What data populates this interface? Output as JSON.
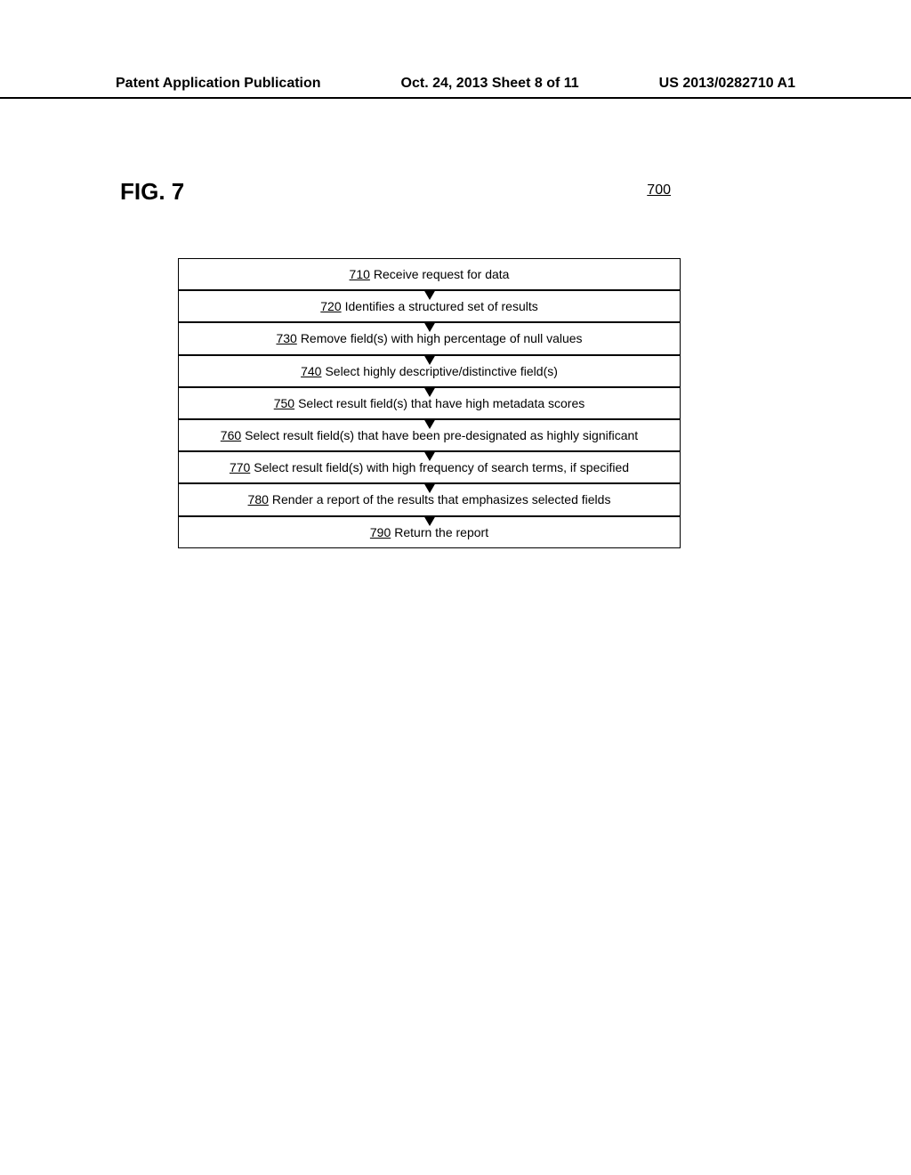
{
  "header": {
    "left": "Patent Application Publication",
    "center": "Oct. 24, 2013  Sheet 8 of 11",
    "right": "US 2013/0282710 A1"
  },
  "figure": {
    "label": "FIG. 7",
    "number": "700"
  },
  "steps": [
    {
      "num": "710",
      "text": "Receive request for data"
    },
    {
      "num": "720",
      "text": "Identifies a structured set of results"
    },
    {
      "num": "730",
      "text": "Remove field(s) with high percentage of null values"
    },
    {
      "num": "740",
      "text": "Select highly descriptive/distinctive field(s)"
    },
    {
      "num": "750",
      "text": "Select result field(s) that have high metadata scores"
    },
    {
      "num": "760",
      "text": "Select result field(s) that have been pre-designated as highly significant"
    },
    {
      "num": "770",
      "text": "Select result field(s) with high frequency of search terms, if specified"
    },
    {
      "num": "780",
      "text": "Render a report of the results that emphasizes selected fields"
    },
    {
      "num": "790",
      "text": "Return the report"
    }
  ]
}
